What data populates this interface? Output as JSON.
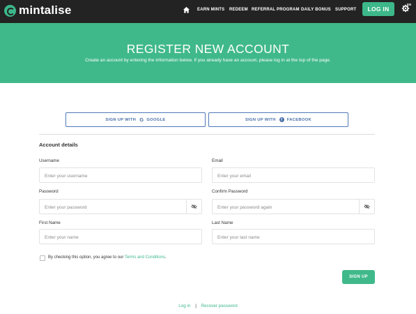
{
  "brand": {
    "name": "mintalise"
  },
  "nav": {
    "items": [
      "EARN MINTS",
      "REDEEM",
      "REFERRAL PROGRAM",
      "DAILY BONUS",
      "SUPPORT"
    ],
    "login_label": "LOG IN",
    "language_code": "EN"
  },
  "banner": {
    "title": "REGISTER NEW ACCOUNT",
    "subtitle": "Create an account by entering the information below. If you already have an account, please log in at the top of the page."
  },
  "social": {
    "google_label": "SIGN UP WITH",
    "google_glyph": "G",
    "google_name": "GOOGLE",
    "facebook_label": "SIGN UP WITH",
    "facebook_glyph": "f",
    "facebook_name": "FACEBOOK"
  },
  "form": {
    "section_title": "Account details",
    "username": {
      "label": "Username",
      "placeholder": "Enter your username"
    },
    "email": {
      "label": "Email",
      "placeholder": "Enter your email"
    },
    "password": {
      "label": "Password",
      "placeholder": "Enter your password"
    },
    "confirm_password": {
      "label": "Confirm Password",
      "placeholder": "Enter your password again"
    },
    "first_name": {
      "label": "First Name",
      "placeholder": "Enter your name"
    },
    "last_name": {
      "label": "Last Name",
      "placeholder": "Enter your last name"
    },
    "agree_text": "By checking this option, you agree to our",
    "terms_link": "Terms and Conditions",
    "agree_end": ".",
    "submit_label": "SIGN UP"
  },
  "footer": {
    "login_link": "Log in",
    "separator": "|",
    "recover_link": "Recover password"
  },
  "colors": {
    "accent": "#40b98a",
    "topbar": "#232323",
    "social_border": "#4e79b8"
  },
  "icons": {
    "home": "home-icon",
    "language": "gear-globe-icon",
    "password_toggle": "eye-slash-icon"
  }
}
